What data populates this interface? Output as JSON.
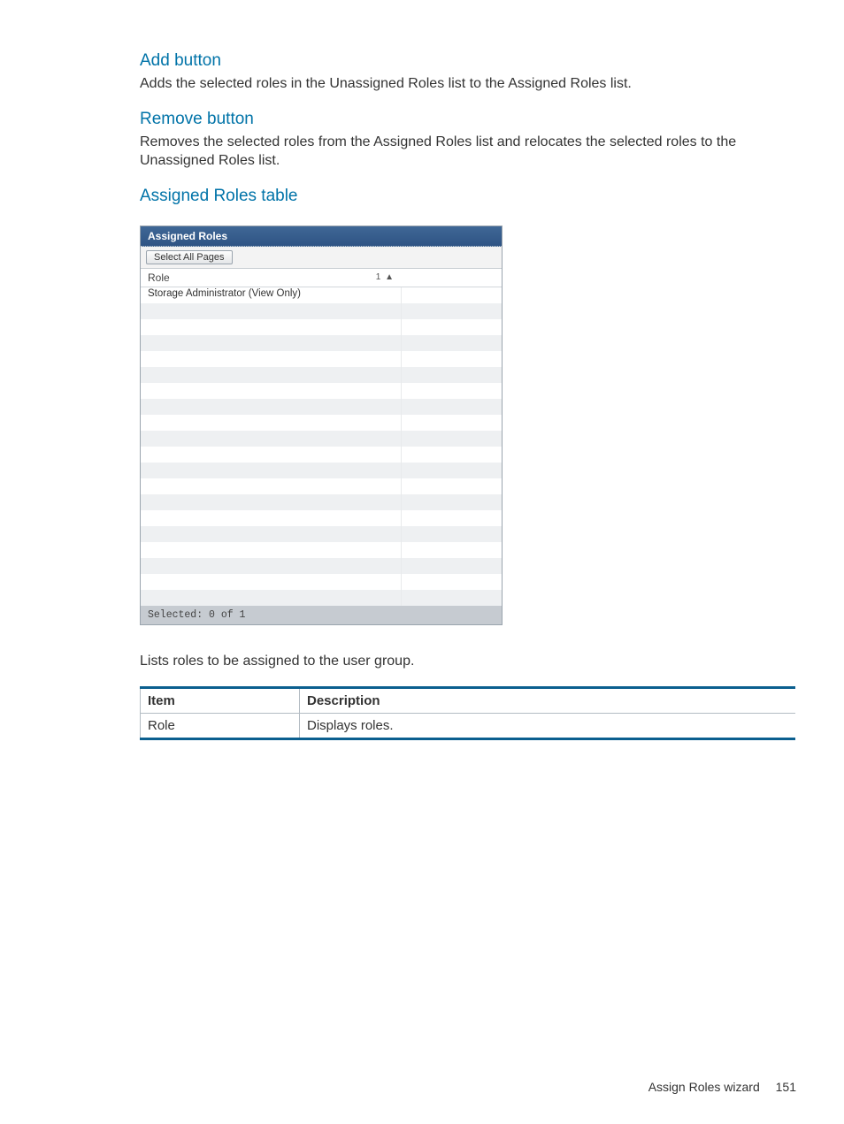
{
  "sections": {
    "add": {
      "heading": "Add button",
      "text": "Adds the selected roles in the Unassigned Roles list to the Assigned Roles list."
    },
    "remove": {
      "heading": "Remove button",
      "text": "Removes the selected roles from the Assigned Roles list and relocates the selected roles to the Unassigned Roles list."
    },
    "assigned": {
      "heading": "Assigned Roles table",
      "caption": "Lists roles to be assigned to the user group."
    }
  },
  "panel": {
    "title": "Assigned Roles",
    "select_all_label": "Select All Pages",
    "column_role": "Role",
    "sort_indicator": "1 ▲",
    "rows": [
      "Storage Administrator (View Only)",
      "",
      "",
      "",
      "",
      "",
      "",
      "",
      "",
      "",
      "",
      "",
      "",
      "",
      "",
      "",
      "",
      "",
      "",
      ""
    ],
    "footer": "Selected: 0  of  1"
  },
  "desc_table": {
    "head_item": "Item",
    "head_desc": "Description",
    "row1_item": "Role",
    "row1_desc": "Displays roles."
  },
  "footer": {
    "label": "Assign Roles wizard",
    "page": "151"
  }
}
